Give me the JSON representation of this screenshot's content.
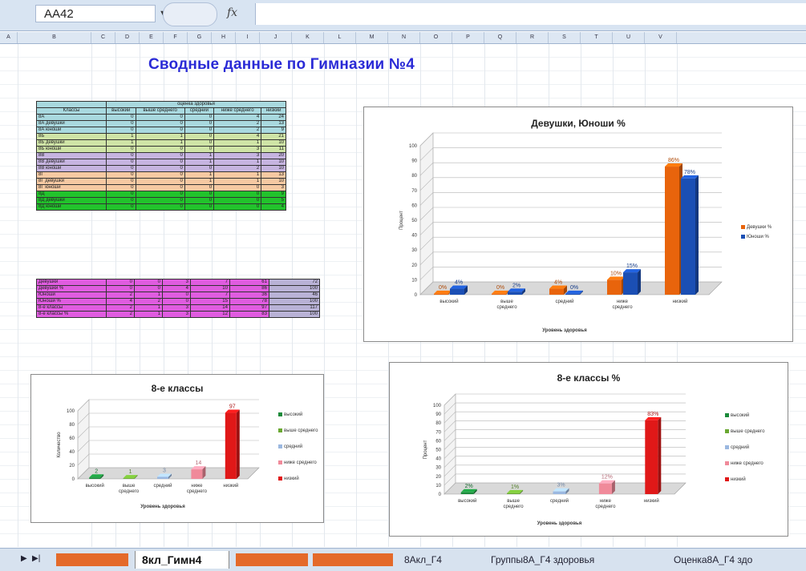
{
  "formula_bar": {
    "name_box": "AA42",
    "fx": "fx",
    "formula": ""
  },
  "columns": [
    "A",
    "B",
    "C",
    "D",
    "E",
    "F",
    "G",
    "H",
    "I",
    "J",
    "K",
    "L",
    "M",
    "N",
    "O",
    "P",
    "Q",
    "R",
    "S",
    "T",
    "U",
    "V"
  ],
  "sheet": {
    "title": "Сводные данные по Гимназии №4"
  },
  "table1": {
    "group_header": "оценка здоровья",
    "headers": [
      "Классы",
      "высокий",
      "выше среднего",
      "средний",
      "ниже среднего",
      "низкий"
    ],
    "rows": [
      {
        "label": "8А",
        "values": [
          "0",
          "0",
          "0",
          "4",
          "24"
        ],
        "color": "#a9d9df"
      },
      {
        "label": "8А девушки",
        "values": [
          "0",
          "0",
          "0",
          "2",
          "13"
        ],
        "color": "#a9d9df"
      },
      {
        "label": "8А юноши",
        "values": [
          "0",
          "0",
          "0",
          "2",
          "9"
        ],
        "color": "#a9d9df"
      },
      {
        "label": "8Б",
        "values": [
          "1",
          "1",
          "0",
          "4",
          "21"
        ],
        "color": "#cfe4a6"
      },
      {
        "label": "8Б девушки",
        "values": [
          "1",
          "1",
          "0",
          "1",
          "10"
        ],
        "color": "#cfe4a6"
      },
      {
        "label": "8Б юноши",
        "values": [
          "0",
          "0",
          "0",
          "3",
          "11"
        ],
        "color": "#cfe4a6"
      },
      {
        "label": "8В",
        "values": [
          "0",
          "0",
          "1",
          "3",
          "20"
        ],
        "color": "#c6b4e0"
      },
      {
        "label": "8В девушки",
        "values": [
          "0",
          "0",
          "1",
          "1",
          "10"
        ],
        "color": "#c6b4e0"
      },
      {
        "label": "8В юноши",
        "values": [
          "0",
          "0",
          "0",
          "2",
          "10"
        ],
        "color": "#c6b4e0"
      },
      {
        "label": "8Г",
        "values": [
          "0",
          "0",
          "1",
          "1",
          "13"
        ],
        "color": "#f6c9a2"
      },
      {
        "label": "8Г девушки",
        "values": [
          "0",
          "0",
          "1",
          "1",
          "10"
        ],
        "color": "#f6c9a2"
      },
      {
        "label": "8Г юноши",
        "values": [
          "0",
          "0",
          "0",
          "0",
          "3"
        ],
        "color": "#f6c9a2"
      },
      {
        "label": "8Д",
        "values": [
          "0",
          "0",
          "0",
          "0",
          "9"
        ],
        "color": "#22c32c"
      },
      {
        "label": "8Д девушки",
        "values": [
          "0",
          "0",
          "0",
          "0",
          "5"
        ],
        "color": "#22c32c"
      },
      {
        "label": "8Д юноши",
        "values": [
          "0",
          "0",
          "0",
          "0",
          "4"
        ],
        "color": "#22c32c"
      }
    ]
  },
  "table2": {
    "rows": [
      {
        "label": "Девушки",
        "values": [
          "0",
          "0",
          "3",
          "7",
          "61",
          "72"
        ]
      },
      {
        "label": "Девушки %",
        "values": [
          "0",
          "0",
          "4",
          "10",
          "86",
          "100"
        ]
      },
      {
        "label": "Юноши",
        "values": [
          "2",
          "1",
          "0",
          "7",
          "36",
          "46"
        ]
      },
      {
        "label": "Юноши %",
        "values": [
          "4",
          "2",
          "0",
          "15",
          "78",
          "100"
        ]
      },
      {
        "label": "8-е классы",
        "values": [
          "2",
          "1",
          "3",
          "14",
          "97",
          "117"
        ]
      },
      {
        "label": "8-е классы %",
        "values": [
          "2",
          "1",
          "3",
          "12",
          "83",
          "100"
        ]
      }
    ]
  },
  "chart_data": [
    {
      "type": "bar",
      "title": "Девушки, Юноши %",
      "xlabel": "Уровень здоровья",
      "ylabel": "Процент",
      "ylim": [
        0,
        100
      ],
      "yticks": [
        0,
        10,
        20,
        30,
        40,
        50,
        60,
        70,
        80,
        90,
        100
      ],
      "categories": [
        "высокий",
        "выше среднего",
        "средний",
        "ниже среднего",
        "низкий"
      ],
      "series": [
        {
          "name": "Девушки %",
          "color": "#e8640c",
          "values": [
            0,
            0,
            4,
            10,
            86
          ],
          "labels": [
            "0%",
            "0%",
            "4%",
            "10%",
            "86%"
          ]
        },
        {
          "name": "Юноши %",
          "color": "#1b4fb4",
          "values": [
            4,
            2,
            0,
            15,
            78
          ],
          "labels": [
            "4%",
            "2%",
            "0%",
            "15%",
            "78%"
          ]
        }
      ],
      "legend": "right"
    },
    {
      "type": "bar",
      "title": "8-е классы",
      "xlabel": "Уровень здоровья",
      "ylabel": "Количество",
      "ylim": [
        0,
        100
      ],
      "yticks": [
        0,
        20,
        40,
        60,
        80,
        100
      ],
      "categories": [
        "высокий",
        "выше среднего",
        "средний",
        "ниже среднего",
        "низкий"
      ],
      "values": [
        2,
        1,
        3,
        14,
        97
      ],
      "labels": [
        "2",
        "1",
        "3",
        "14",
        "97"
      ],
      "colors": [
        "#1b8a3a",
        "#6aa832",
        "#9bb8e0",
        "#f08a9a",
        "#e01818"
      ],
      "legend": "right"
    },
    {
      "type": "bar",
      "title": "8-е классы %",
      "xlabel": "Уровень здоровья",
      "ylabel": "Процент",
      "ylim": [
        0,
        100
      ],
      "yticks": [
        0,
        10,
        20,
        30,
        40,
        50,
        60,
        70,
        80,
        90,
        100
      ],
      "categories": [
        "высокий",
        "выше среднего",
        "средний",
        "ниже среднего",
        "низкий"
      ],
      "values": [
        2,
        1,
        3,
        12,
        83
      ],
      "labels": [
        "2%",
        "1%",
        "3%",
        "12%",
        "83%"
      ],
      "colors": [
        "#1b8a3a",
        "#6aa832",
        "#9bb8e0",
        "#f08a9a",
        "#e01818"
      ],
      "legend": "right"
    }
  ],
  "tabs": [
    {
      "label": "",
      "state": "dim"
    },
    {
      "label": "8кл_Гимн4",
      "state": "active"
    },
    {
      "label": "",
      "state": "dim"
    },
    {
      "label": "",
      "state": "dim"
    },
    {
      "label": "8Акл_Г4",
      "state": "plain"
    },
    {
      "label": "Группы8А_Г4 здоровья",
      "state": "plain"
    },
    {
      "label": "Оценка8А_Г4 здо",
      "state": "plain"
    }
  ]
}
